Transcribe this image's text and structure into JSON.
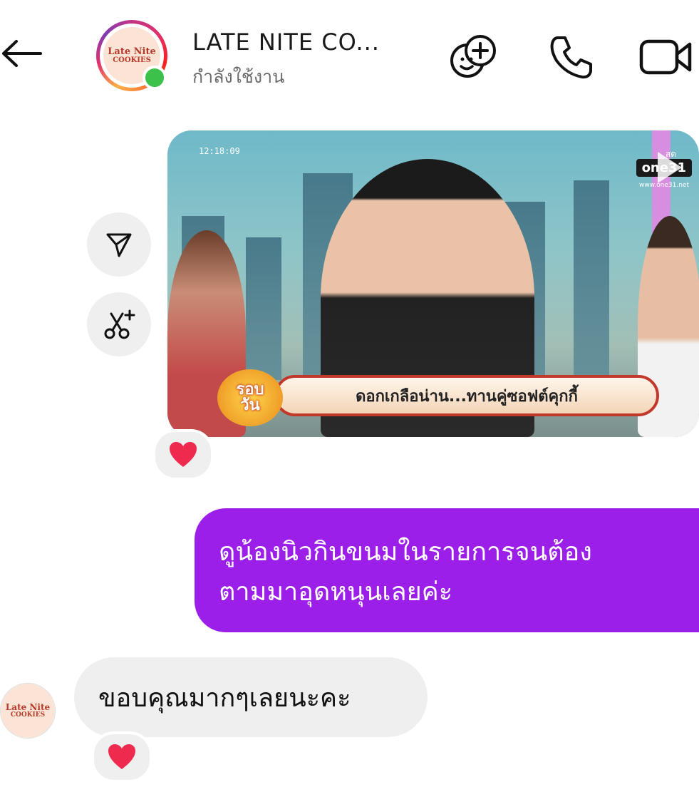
{
  "header": {
    "back_icon": "arrow-left-icon",
    "contact_name": "LATE NITE CO...",
    "contact_status": "กำลังใช้งาน",
    "avatar_logo": {
      "line1": "Late Nite",
      "line2": "COOKIES"
    },
    "actions": [
      {
        "icon": "add-effect-icon"
      },
      {
        "icon": "phone-icon"
      },
      {
        "icon": "video-camera-icon"
      }
    ]
  },
  "media_message": {
    "timestamp_overlay": "12:18:09",
    "channel": "one31",
    "channel_url": "www.one31.net",
    "live_text": "สด",
    "show_logo": {
      "line1": "รอบ",
      "line2": "วัน"
    },
    "caption": "ดอกเกลือน่าน...ทานคู่ซอฟต์คุกกี้",
    "reaction": "❤️",
    "side_actions": [
      {
        "icon": "share-icon"
      },
      {
        "icon": "remix-scissors-icon"
      }
    ]
  },
  "outgoing_message": {
    "line1": "ดูน้องนิวกินขนมในรายการจนต้อง",
    "line2": "ตามมาอุดหนุนเลยค่ะ"
  },
  "incoming_message": {
    "text": "ขอบคุณมากๆเลยนะคะ",
    "reaction": "❤️"
  },
  "colors": {
    "outgoing_bubble": "#9b1fe8",
    "incoming_bubble": "#efefef",
    "online_dot": "#3cc14a"
  }
}
